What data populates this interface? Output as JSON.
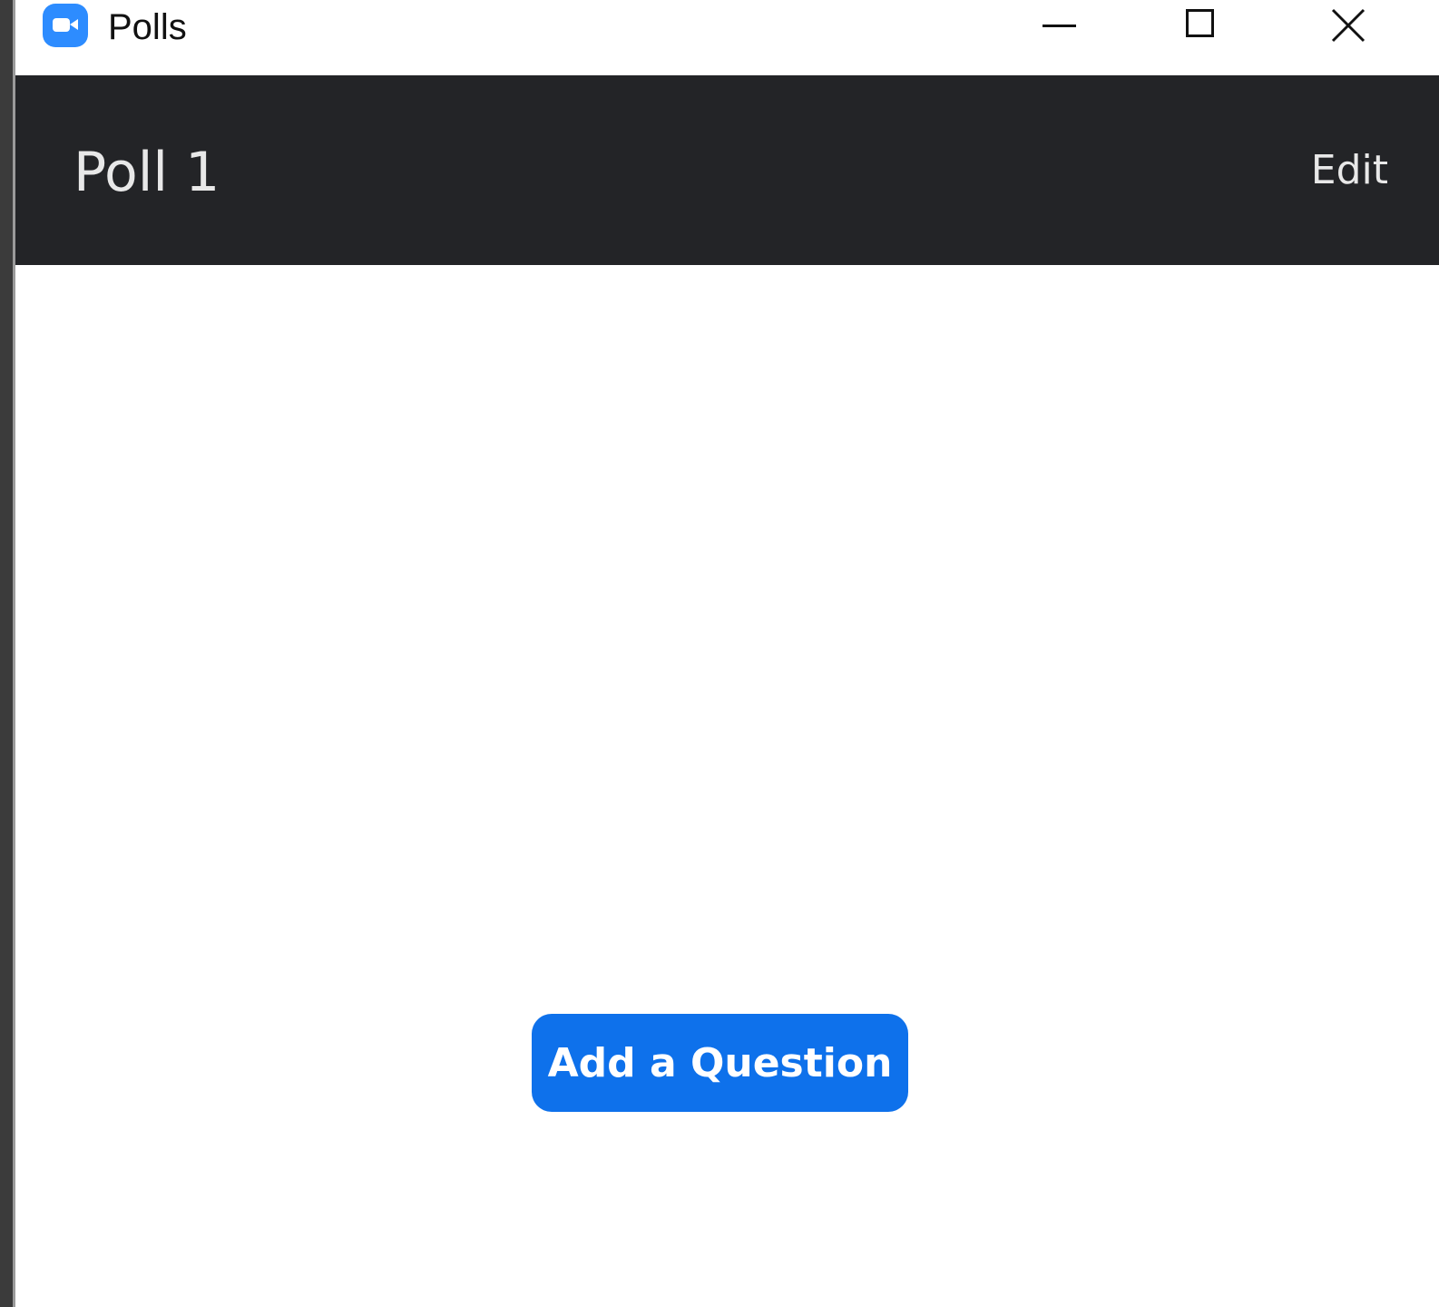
{
  "window": {
    "title": "Polls",
    "app_icon": "zoom-camera-icon",
    "controls": {
      "minimize": "minimize-icon",
      "maximize": "maximize-icon",
      "close": "close-icon"
    }
  },
  "header": {
    "poll_title": "Poll 1",
    "edit_label": "Edit"
  },
  "main": {
    "add_question_label": "Add a Question"
  },
  "colors": {
    "header_bg": "#232427",
    "accent": "#0e71eb",
    "app_icon": "#2d8cff"
  }
}
